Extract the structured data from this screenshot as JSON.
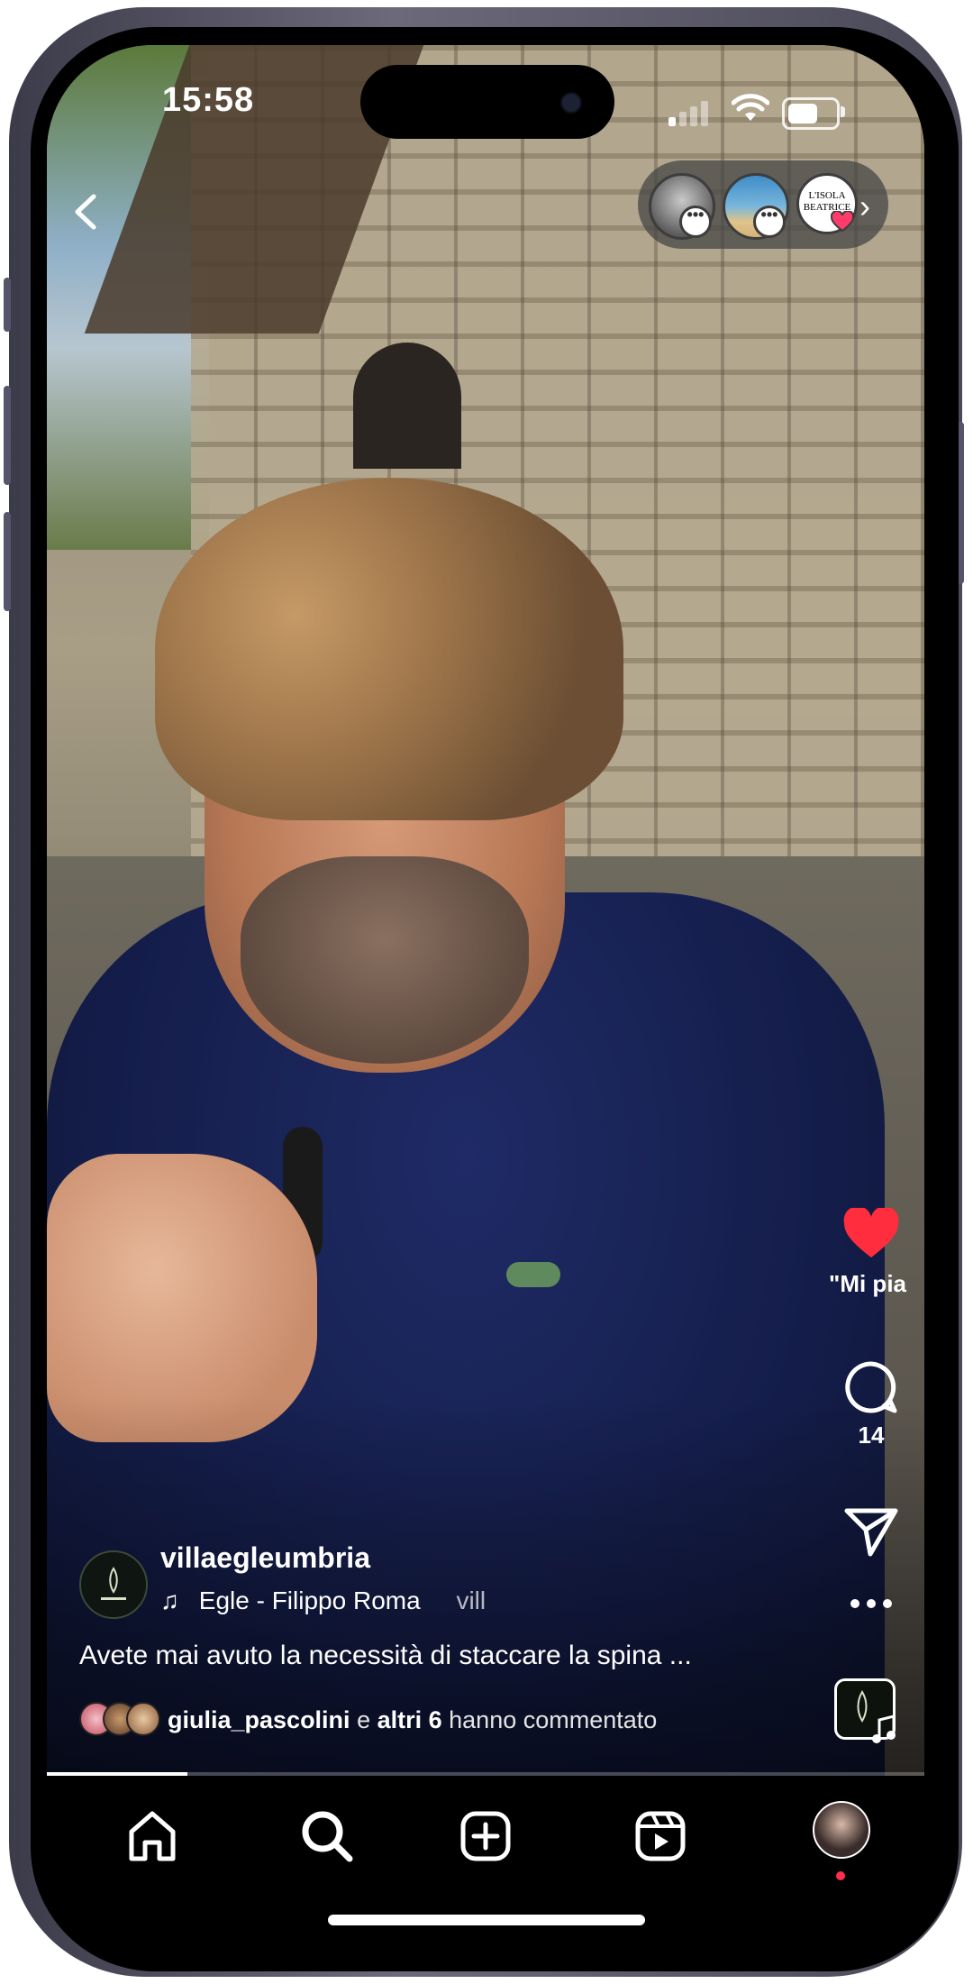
{
  "status_bar": {
    "time": "15:58",
    "battery_percent": 70
  },
  "stories": {
    "items": [
      {
        "name": "story-1"
      },
      {
        "name": "story-2"
      },
      {
        "name": "story-3",
        "logo_text": "L'ISOLA BEATRICE"
      }
    ]
  },
  "actions": {
    "like_label": "\"Mi pia",
    "comments_count": "14"
  },
  "post": {
    "username": "villaegleumbria",
    "music_title": "Egle - Filippo Roma",
    "music_scroll": "vill",
    "caption": "Avete mai avuto la necessità di staccare la spina ...",
    "commenters": {
      "first": "giulia_pascolini",
      "and": " e ",
      "others": "altri 6",
      "suffix": " hanno commentato"
    }
  },
  "video_progress": 0.16,
  "colors": {
    "like": "#ff2d3d",
    "notification_dot": "#ff2e4d",
    "nav_bg": "#000000"
  },
  "nav": {
    "items": [
      {
        "icon": "home-icon"
      },
      {
        "icon": "search-icon"
      },
      {
        "icon": "create-icon"
      },
      {
        "icon": "reels-icon"
      },
      {
        "icon": "profile-avatar"
      }
    ]
  }
}
